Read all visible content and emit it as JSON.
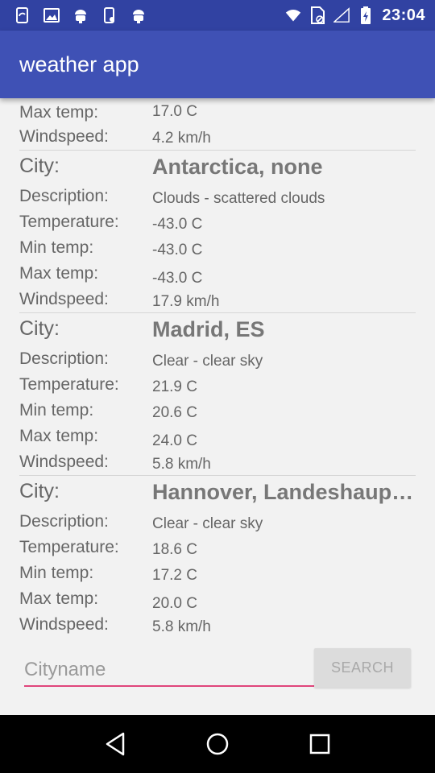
{
  "status_bar": {
    "time": "23:04",
    "left_icons": [
      "sync-icon",
      "image-icon",
      "android-icon",
      "phone-sync-icon",
      "android-icon"
    ],
    "right_icons": [
      "wifi-icon",
      "no-sim-icon",
      "signal-icon",
      "battery-icon"
    ]
  },
  "app_bar": {
    "title": "weather app"
  },
  "colors": {
    "status_bar": "#3142a2",
    "app_bar": "#3f51b5",
    "accent": "#e0457b",
    "background": "#f2f2f2"
  },
  "labels": {
    "city": "City:",
    "description": "Description:",
    "temperature": "Temperature:",
    "min_temp": "Min temp:",
    "max_temp": "Max temp:",
    "windspeed": "Windspeed:"
  },
  "partial_entry": {
    "max_temp": "17.0 C",
    "windspeed": "4.2 km/h"
  },
  "entries": [
    {
      "city": "Antarctica, none",
      "description": "Clouds - scattered clouds",
      "temperature": "-43.0 C",
      "min_temp": "-43.0 C",
      "max_temp": "-43.0 C",
      "windspeed": "17.9 km/h"
    },
    {
      "city": "Madrid, ES",
      "description": "Clear - clear sky",
      "temperature": "21.9 C",
      "min_temp": "20.6 C",
      "max_temp": "24.0 C",
      "windspeed": "5.8 km/h"
    },
    {
      "city": "Hannover, Landeshaup…",
      "description": "Clear - clear sky",
      "temperature": "18.6 C",
      "min_temp": "17.2 C",
      "max_temp": "20.0 C",
      "windspeed": "5.8 km/h"
    }
  ],
  "search": {
    "placeholder": "Cityname",
    "value": "",
    "button_label": "SEARCH"
  },
  "nav_bar": {
    "icons": [
      "back-icon",
      "home-icon",
      "recents-icon"
    ]
  }
}
